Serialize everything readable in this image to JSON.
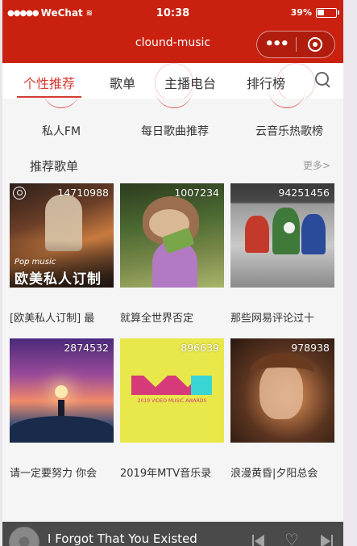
{
  "status_bar": {
    "carrier": "WeChat",
    "time": "10:38",
    "battery": "39%"
  },
  "nav": {
    "title": "clound-music"
  },
  "tabs": [
    {
      "label": "个性推荐",
      "active": true
    },
    {
      "label": "歌单",
      "active": false
    },
    {
      "label": "主播电台",
      "active": false
    },
    {
      "label": "排行榜",
      "active": false
    }
  ],
  "quick_entries": [
    {
      "label": "私人FM",
      "icon": "radio-icon"
    },
    {
      "label": "每日歌曲推荐",
      "icon": "calendar-icon"
    },
    {
      "label": "云音乐热歌榜",
      "icon": "chart-icon"
    }
  ],
  "section": {
    "title": "推荐歌单",
    "more": "更多>"
  },
  "playlists": [
    {
      "play_count": "14710988",
      "title": "[欧美私人订制] 最",
      "overlay_tag": "Pop music",
      "overlay_title": "欧美私人订制",
      "colors": [
        "#3b2a25",
        "#c77a3f"
      ]
    },
    {
      "play_count": "1007234",
      "title": "就算全世界否定",
      "colors": [
        "#3d5a2a",
        "#b08a6a"
      ]
    },
    {
      "play_count": "94251456",
      "title": "那些网易评论过十",
      "colors": [
        "#5a5a5a",
        "#c2c2c2"
      ]
    },
    {
      "play_count": "2874532",
      "title": "请一定要努力 你会",
      "colors": [
        "#2a4a8a",
        "#f08a6a"
      ]
    },
    {
      "play_count": "896639",
      "title": "2019年MTV音乐录",
      "overlay_title": "2019 VIDEO MUSIC AWARDS",
      "colors": [
        "#e8e84a",
        "#f2f25a"
      ]
    },
    {
      "play_count": "978938",
      "title": "浪漫黄昏|夕阳总会",
      "colors": [
        "#2a1810",
        "#a86a40"
      ]
    }
  ],
  "player": {
    "song_title": "I Forgot That You Existed"
  }
}
